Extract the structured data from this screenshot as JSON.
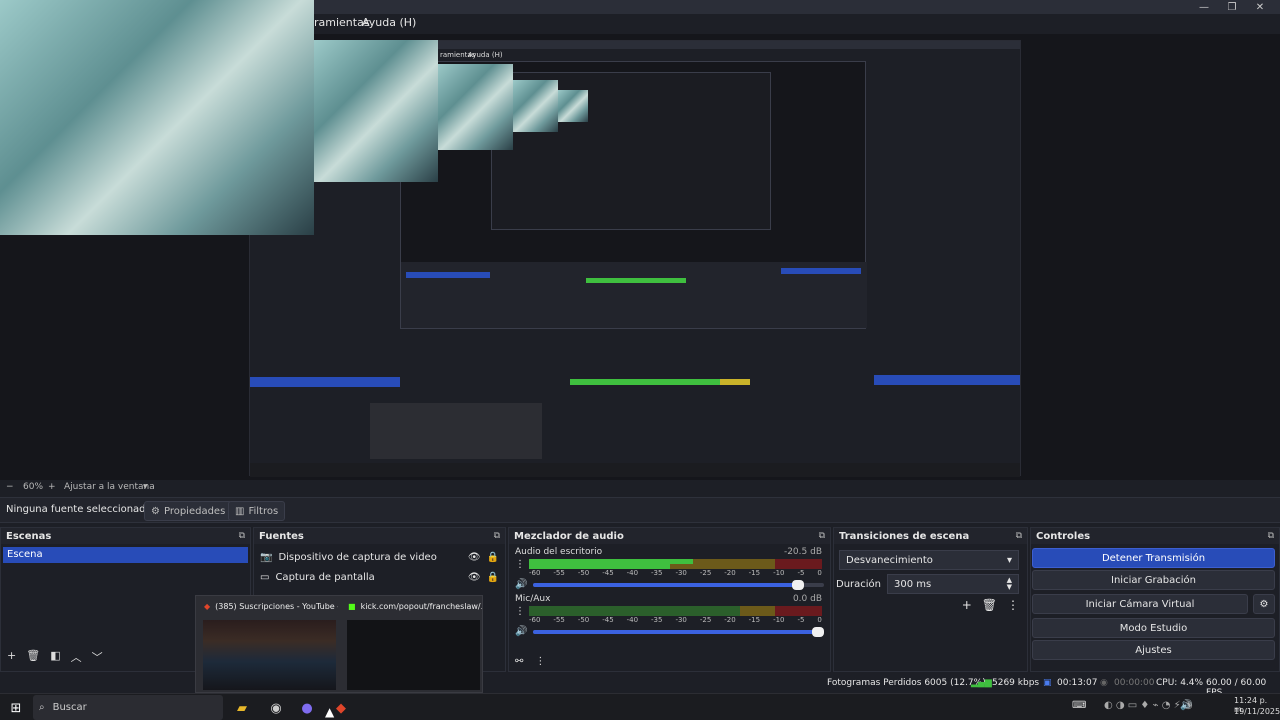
{
  "menu": {
    "items": [
      "ramientas",
      "Ayuda (H)"
    ],
    "mirror_items": [
      "ramientas",
      "Ayuda (H)"
    ]
  },
  "zoom": {
    "minus": "−",
    "level": "60%",
    "plus": "+",
    "fit_label": "Ajustar a la ventana",
    "dropdown": "▾"
  },
  "context": {
    "selection_text": "Ninguna fuente seleccionad",
    "properties_label": "Propiedades",
    "filters_label": "Filtros"
  },
  "scenes": {
    "title": "Escenas",
    "items": [
      "Escena"
    ]
  },
  "sources": {
    "title": "Fuentes",
    "items": [
      {
        "name": "Dispositivo de captura de video",
        "icon": "camera-icon"
      },
      {
        "name": "Captura de pantalla",
        "icon": "monitor-icon"
      }
    ]
  },
  "mixer": {
    "title": "Mezclador de audio",
    "channels": [
      {
        "name": "Audio del escritorio",
        "db": "-20.5 dB",
        "volume": 0.93
      },
      {
        "name": "Mic/Aux",
        "db": "0.0 dB",
        "volume": 1.0
      }
    ],
    "scale": [
      "-60",
      "-55",
      "-50",
      "-45",
      "-40",
      "-35",
      "-30",
      "-25",
      "-20",
      "-15",
      "-10",
      "-5",
      "0"
    ]
  },
  "transitions": {
    "title": "Transiciones de escena",
    "selected": "Desvanecimiento",
    "duration_label": "Duración",
    "duration_value": "300 ms"
  },
  "controls": {
    "title": "Controles",
    "buttons": [
      "Detener Transmisión",
      "Iniciar Grabación",
      "Iniciar Cámara Virtual",
      "Modo Estudio",
      "Ajustes"
    ]
  },
  "status": {
    "dropped": "Fotogramas Perdidos 6005 (12.7%)",
    "bitrate": "5269 kbps",
    "stream_time": "00:13:07",
    "rec_time": "00:00:00",
    "cpu": "CPU: 4.4%",
    "fps": "60.00 / 60.00 FPS"
  },
  "taskbar": {
    "search_placeholder": "Buscar",
    "time": "11:24 p. m.",
    "date": "19/11/2025"
  },
  "popup": {
    "items": [
      {
        "title": "(385) Suscripciones - YouTube - ..."
      },
      {
        "title": "kick.com/popout/francheslaw/..."
      }
    ]
  },
  "colors": {
    "accent": "#284cb8",
    "meter_green": "#3fbf3f",
    "meter_yellow": "#c9b32a",
    "meter_red": "#b5242a"
  }
}
